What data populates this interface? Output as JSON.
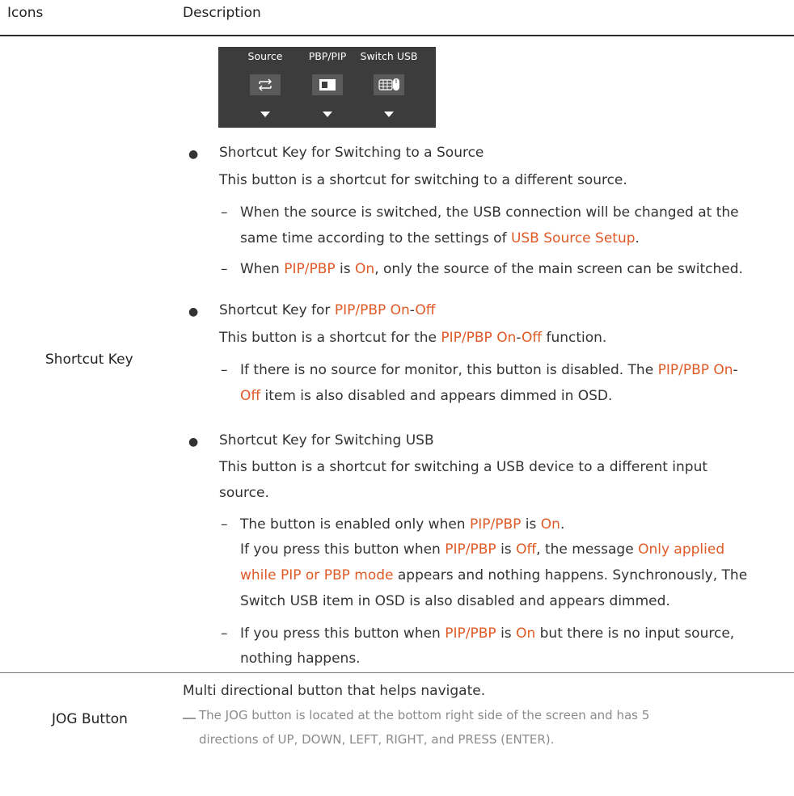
{
  "header": {
    "col_icons": "Icons",
    "col_description": "Description"
  },
  "rows": {
    "shortcut_key": "Shortcut Key",
    "jog_button": "JOG Button"
  },
  "osd_panel": {
    "labels": [
      "Source",
      "PBP/PIP",
      "Switch USB"
    ],
    "icons": [
      "source-switch-icon",
      "pbp-pip-icon",
      "switch-usb-icon"
    ],
    "background": "#3c3c3c"
  },
  "shortcut": {
    "b1_title": "Shortcut Key for Switching to a Source",
    "b1_desc": "This button is a shortcut for switching to a different source.",
    "b1_d1_l1": "When the source is switched, the USB connection will be changed at the",
    "b1_d1_l2a": "same time according to the settings of ",
    "b1_d1_l2b": "USB Source Setup",
    "b1_d1_l2c": ".",
    "b1_d2_a": "When ",
    "b1_d2_b": "PIP/PBP",
    "b1_d2_c": " is ",
    "b1_d2_d": "On",
    "b1_d2_e": ", only the source of the main screen can be switched.",
    "b2_title_a": "Shortcut Key for ",
    "b2_title_b": "PIP/PBP On",
    "b2_title_c": "-",
    "b2_title_d": "Off",
    "b2_desc_a": "This button is a shortcut for the ",
    "b2_desc_b": "PIP/PBP On",
    "b2_desc_c": "-",
    "b2_desc_d": "Off",
    "b2_desc_e": " function.",
    "b2_d1_l1a": "If there is no source for monitor, this button is disabled. The ",
    "b2_d1_l1b": "PIP/PBP On",
    "b2_d1_l1c": "-",
    "b2_d1_l2a": "Off",
    "b2_d1_l2b": " item is also disabled and appears dimmed in OSD.",
    "b3_title": "Shortcut Key for Switching USB",
    "b3_desc_l1": "This button is a shortcut for switching a USB device to a different input",
    "b3_desc_l2": "source.",
    "b3_d1_a": "The button is enabled only when ",
    "b3_d1_b": "PIP/PBP",
    "b3_d1_c": " is ",
    "b3_d1_d": "On",
    "b3_d1_e": ".",
    "b3_p_l1a": "If you press this button when ",
    "b3_p_l1b": "PIP/PBP",
    "b3_p_l1c": " is ",
    "b3_p_l1d": "Off",
    "b3_p_l1e": ", the message ",
    "b3_p_l1f": "Only applied",
    "b3_p_l2a": "while PIP or PBP mode",
    "b3_p_l2b": " appears and nothing happens. Synchronously, The",
    "b3_p_l3": "Switch USB item in OSD is also disabled and appears dimmed.",
    "b3_d2_l1a": "If you press this button when ",
    "b3_d2_l1b": "PIP/PBP",
    "b3_d2_l1c": " is ",
    "b3_d2_l1d": "On",
    "b3_d2_l1e": " but there is no input source,",
    "b3_d2_l2": "nothing happens."
  },
  "jog": {
    "desc": "Multi directional button that helps navigate.",
    "note_l1": "The JOG button is located at the bottom right side of the screen and has 5",
    "note_l2": "directions of UP, DOWN, LEFT, RIGHT, and PRESS (ENTER)."
  },
  "colors": {
    "highlight": "#e05a26",
    "text": "#333333",
    "note": "#8b8b8b"
  }
}
